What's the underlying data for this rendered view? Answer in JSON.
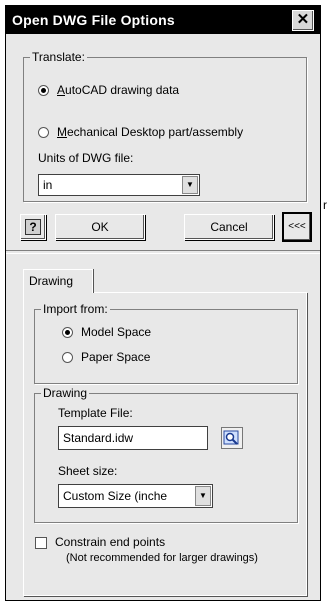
{
  "window": {
    "title": "Open DWG File Options",
    "close_label": "✕"
  },
  "translate": {
    "legend": "Translate:",
    "options": [
      {
        "label_ul": "A",
        "label_rest": "utoCAD drawing data",
        "selected": true
      },
      {
        "label_ul": "M",
        "label_rest": "echanical Desktop part/assembly",
        "selected": false
      }
    ],
    "units_label": "Units of DWG file:",
    "units_value": "in"
  },
  "buttons": {
    "help": "?",
    "ok": "OK",
    "cancel": "Cancel",
    "collapse": "<<<"
  },
  "side_marker": "r",
  "tabs": [
    {
      "label": "Drawing"
    }
  ],
  "import_from": {
    "legend": "Import from:",
    "options": [
      {
        "label": "Model Space",
        "selected": true
      },
      {
        "label": "Paper Space",
        "selected": false
      }
    ]
  },
  "drawing": {
    "legend": "Drawing",
    "template_label": "Template File:",
    "template_value": "Standard.idw",
    "sheet_label": "Sheet size:",
    "sheet_value": "Custom Size (inche"
  },
  "constrain": {
    "label": "Constrain end points",
    "note": "(Not recommended for larger drawings)",
    "checked": false
  }
}
